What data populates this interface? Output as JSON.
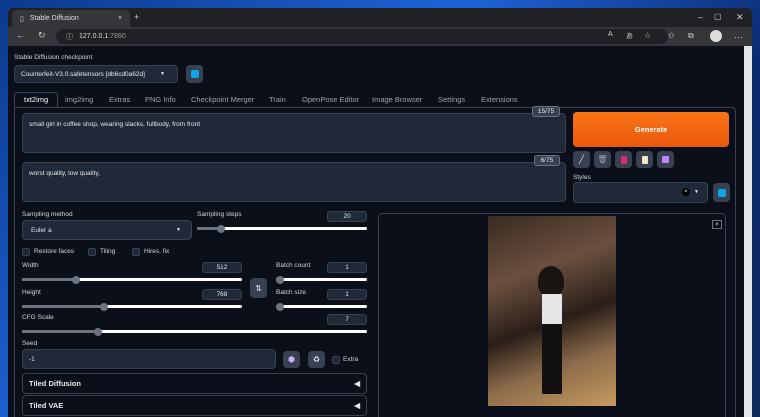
{
  "browser": {
    "tab_title": "Stable Diffusion",
    "url_host": "127.0.0.1",
    "url_port": ":7860"
  },
  "checkpoint": {
    "label": "Stable Diffusion checkpoint",
    "value": "Counterfeit-V3.0.safetensors [db6cd0a62d]"
  },
  "tabs": [
    "txt2img",
    "img2img",
    "Extras",
    "PNG Info",
    "Checkpoint Merger",
    "Train",
    "OpenPose Editor",
    "Image Browser",
    "Settings",
    "Extensions"
  ],
  "prompt": {
    "value": "small girl in coffee shop, wearing slacks, fullbody, from front",
    "counter": "15/75"
  },
  "negative_prompt": {
    "value": "worst quality, low quality,",
    "counter": "6/75"
  },
  "generate_label": "Generate",
  "styles_label": "Styles",
  "sampling_method": {
    "label": "Sampling method",
    "value": "Euler a"
  },
  "sampling_steps": {
    "label": "Sampling steps",
    "value": "20"
  },
  "checkboxes": [
    "Restore faces",
    "Tiling",
    "Hires. fix"
  ],
  "width": {
    "label": "Width",
    "value": "512"
  },
  "height": {
    "label": "Height",
    "value": "768"
  },
  "batch_count": {
    "label": "Batch count",
    "value": "1"
  },
  "batch_size": {
    "label": "Batch size",
    "value": "1"
  },
  "cfg_scale": {
    "label": "CFG Scale",
    "value": "7"
  },
  "seed": {
    "label": "Seed",
    "value": "-1",
    "extra_label": "Extra"
  },
  "accordions": [
    "Tiled Diffusion",
    "Tiled VAE"
  ],
  "colors": {
    "accent": "#f97316",
    "bg": "#0b0f19",
    "panel": "#1f2937"
  }
}
